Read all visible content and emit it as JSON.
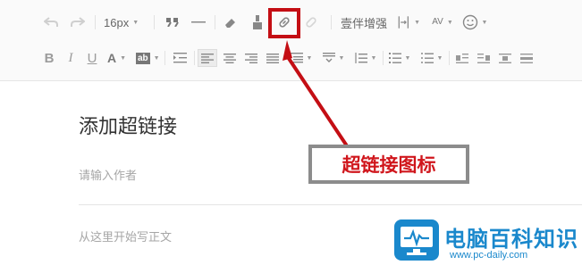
{
  "toolbar": {
    "row1": {
      "font_size": "16px",
      "text_enhance": "壹伴增强",
      "letter_spacing_label": "AV"
    },
    "row2": {
      "bold": "B",
      "italic": "I",
      "underline": "U",
      "font_color": "A",
      "bg_color": "ab"
    }
  },
  "editor": {
    "title": "添加超链接",
    "author_placeholder": "请输入作者",
    "body_placeholder": "从这里开始写正文"
  },
  "annotation": {
    "label": "超链接图标",
    "color": "#c40e14"
  },
  "watermark": {
    "title": "电脑百科知识",
    "url": "www.pc-daily.com",
    "color": "#1a88cc"
  }
}
